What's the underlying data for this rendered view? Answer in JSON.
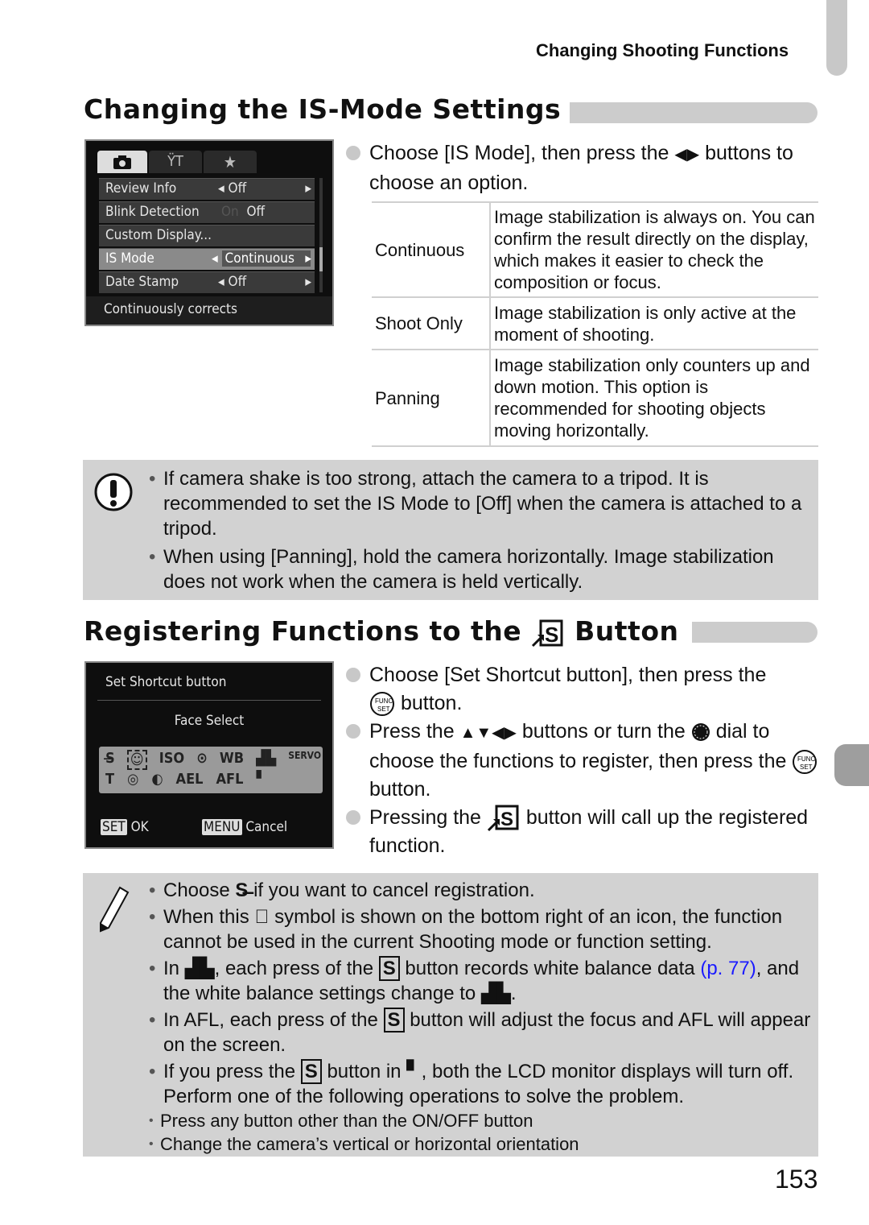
{
  "header": {
    "running_title": "Changing Shooting Functions"
  },
  "section1": {
    "title": "Changing the IS-Mode Settings",
    "lcd": {
      "tabs": [
        "camera-icon",
        "tools-icon",
        "star-icon"
      ],
      "rows": [
        {
          "label": "Review Info",
          "value": "Off"
        },
        {
          "label": "Blink Detection",
          "value_dim": "On",
          "value": "Off"
        },
        {
          "label": "Custom Display...",
          "value": ""
        },
        {
          "label": "IS Mode",
          "value": "Continuous"
        },
        {
          "label": "Date Stamp",
          "value": "Off"
        }
      ],
      "footer": "Continuously corrects"
    },
    "step": {
      "text_a": "Choose [IS Mode], then press the",
      "arrows": "◀▶",
      "text_b": "buttons to choose an option."
    },
    "options": [
      {
        "name": "Continuous",
        "desc": "Image stabilization is always on. You can confirm the result directly on the display, which makes it easier to check the composition or focus."
      },
      {
        "name": "Shoot Only",
        "desc": "Image stabilization is only active at the moment of shooting."
      },
      {
        "name": "Panning",
        "desc": "Image stabilization only counters up and down motion. This option is recommended for shooting objects moving horizontally."
      }
    ],
    "caution": [
      "If camera shake is too strong, attach the camera to a tripod. It is recommended to set the IS Mode to [Off] when the camera is attached to a tripod.",
      "When using [Panning], hold the camera horizontally. Image stabilization does not work when the camera is held vertically."
    ]
  },
  "section2": {
    "title_a": "Registering Functions to the",
    "title_b": "Button",
    "lcd": {
      "title": "Set Shortcut button",
      "selected": "Face Select",
      "row1": [
        "S×",
        "face",
        "ISO",
        "meter",
        "WB",
        "custom-wb",
        "SERVO"
      ],
      "row2": [
        "T",
        "eye",
        "i-contrast",
        "AEL",
        "AFL",
        "display-off"
      ],
      "ok_key": "SET",
      "ok_label": "OK",
      "cancel_key": "MENU",
      "cancel_label": "Cancel"
    },
    "steps": [
      {
        "a": "Choose [Set Shortcut button], then press the",
        "b": "button."
      },
      {
        "a": "Press the",
        "arrows": "▲▼◀▶",
        "b": "buttons or turn the",
        "c": "dial to choose the functions to register, then press the",
        "d": "button."
      },
      {
        "a": "Pressing the",
        "b": "button will call up the registered function."
      }
    ],
    "notes": {
      "n1a": "Choose",
      "n1b": "if you want to cancel registration.",
      "n2a": "When this",
      "n2b": "symbol is shown on the bottom right of an icon, the function cannot be used in the current Shooting mode or function setting.",
      "n3a": "In",
      "n3b": ", each press of the",
      "n3c": "button records white balance data",
      "n3link": "(p. 77)",
      "n3d": ", and the white balance settings change to",
      "n3e": ".",
      "n4a": "In",
      "n4afl": "AFL",
      "n4b": ", each press of the",
      "n4c": "button will adjust the focus and",
      "n4d": "will appear on the screen.",
      "n5a": "If you press the",
      "n5b": "button in",
      "n5c": ", both the LCD monitor displays will turn off. Perform one of the following operations to solve the problem.",
      "subs": [
        "Press any button other than the ON/OFF button",
        "Change the camera’s vertical or horizontal orientation"
      ]
    }
  },
  "page_number": "153",
  "colors": {
    "link": "#1a1aff",
    "note_bg": "#d2d2d2",
    "tab_gray": "#c8c8c8"
  }
}
